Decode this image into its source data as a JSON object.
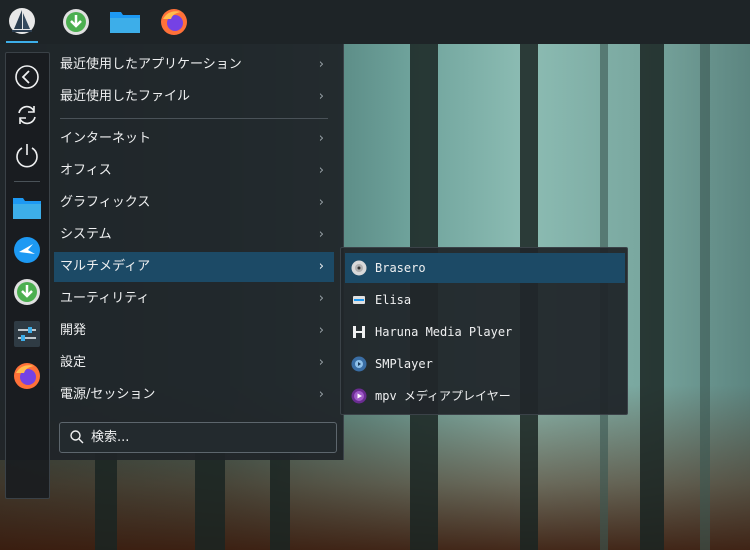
{
  "panel": {
    "launcher_icon": "sailboat-icon",
    "apps": [
      {
        "name": "download-manager-icon"
      },
      {
        "name": "file-manager-icon"
      },
      {
        "name": "firefox-icon"
      }
    ]
  },
  "favorites": [
    {
      "name": "back-icon"
    },
    {
      "name": "refresh-icon"
    },
    {
      "name": "power-icon"
    },
    {
      "name": "folder-icon"
    },
    {
      "name": "kstars-icon"
    },
    {
      "name": "download-icon"
    },
    {
      "name": "settings-icon"
    },
    {
      "name": "firefox-icon"
    }
  ],
  "categories": [
    {
      "label": "最近使用したアプリケーション"
    },
    {
      "label": "最近使用したファイル"
    },
    {
      "label": "インターネット"
    },
    {
      "label": "オフィス"
    },
    {
      "label": "グラフィックス"
    },
    {
      "label": "システム"
    },
    {
      "label": "マルチメディア"
    },
    {
      "label": "ユーティリティ"
    },
    {
      "label": "開発"
    },
    {
      "label": "設定"
    },
    {
      "label": "電源/セッション"
    }
  ],
  "chevron": "›",
  "search": {
    "placeholder": "検索..."
  },
  "submenu": [
    {
      "label": "Brasero",
      "icon": "disc-icon"
    },
    {
      "label": "Elisa",
      "icon": "music-player-icon"
    },
    {
      "label": "Haruna Media Player",
      "icon": "haruna-icon"
    },
    {
      "label": "SMPlayer",
      "icon": "smplayer-icon"
    },
    {
      "label": "mpv メディアプレイヤー",
      "icon": "mpv-icon"
    }
  ],
  "colors": {
    "accent": "#3daee9",
    "selection": "#1c4a66"
  }
}
